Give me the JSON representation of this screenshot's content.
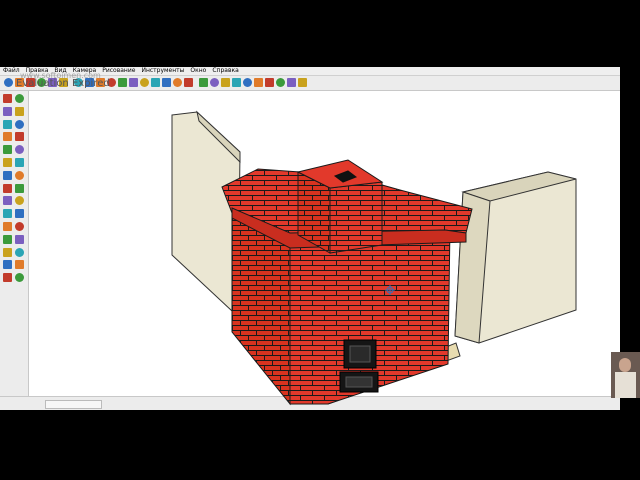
{
  "menubar": {
    "items": [
      "Файл",
      "Правка",
      "Вид",
      "Камера",
      "Рисование",
      "Инструменты",
      "Окно",
      "Справка"
    ]
  },
  "watermark": {
    "site": "www.softoimen.com",
    "notice": "Evaluation Expired"
  },
  "colors": {
    "brick": "#e2392b",
    "mortar": "#1f1f1f",
    "wall_face": "#ebe7d3",
    "wall_side": "#d9d4bb",
    "base": "#e8dcb0",
    "toolbar": "#ececec"
  },
  "toolbar": {
    "icons": [
      "select-icon",
      "eraser-icon",
      "paint-icon",
      "line-icon",
      "arc-icon",
      "rectangle-icon",
      "push-pull-icon",
      "move-icon",
      "rotate-icon",
      "offset-icon",
      "tape-icon",
      "dimension-icon",
      "text-icon",
      "axes-icon",
      "orbit-icon",
      "pan-icon",
      "zoom-icon",
      "zoom-window-icon",
      "zoom-extents-icon",
      "previous-view-icon",
      "walk-icon",
      "look-around-icon",
      "position-camera-icon",
      "section-icon",
      "3d-warehouse-icon",
      "components-icon",
      "materials-icon"
    ]
  },
  "left_tools": {
    "icons": [
      "select-icon",
      "make-component-icon",
      "paint-bucket-icon",
      "eraser-icon",
      "rectangle-icon",
      "line-icon",
      "circle-icon",
      "arc-icon",
      "polygon-icon",
      "freehand-icon",
      "move-icon",
      "push-pull-icon",
      "rotate-icon",
      "follow-me-icon",
      "scale-icon",
      "offset-icon",
      "tape-measure-icon",
      "dimension-icon",
      "protractor-icon",
      "text-icon",
      "axes-icon",
      "3d-text-icon",
      "orbit-icon",
      "pan-icon",
      "zoom-icon",
      "zoom-extents-icon",
      "position-camera-icon",
      "walk-icon",
      "look-around-icon",
      "section-plane-icon"
    ]
  }
}
